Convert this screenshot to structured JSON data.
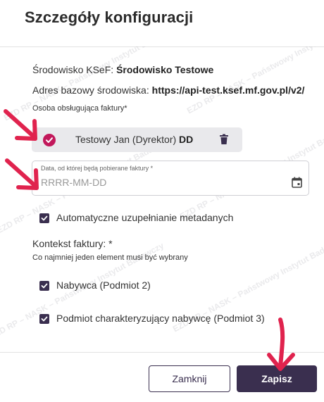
{
  "dialog": {
    "title": "Szczegóły konfiguracji"
  },
  "environment": {
    "label": "Środowisko KSeF:",
    "value": "Środowisko Testowe"
  },
  "base_address": {
    "label": "Adres bazowy środowiska:",
    "value": "https://api-test.ksef.mf.gov.pl/v2/"
  },
  "invoice_person": {
    "label": "Osoba obsługująca faktury*",
    "name": "Testowy Jan (Dyrektor)",
    "suffix": "DD"
  },
  "date_field": {
    "label": "Data, od której będą pobierane faktury *",
    "placeholder": "RRRR-MM-DD",
    "value": ""
  },
  "auto_metadata": {
    "label": "Automatyczne uzupełnianie metadanych",
    "checked": true
  },
  "invoice_context": {
    "heading": "Kontekst faktury: *",
    "hint": "Co najmniej jeden element musi być wybrany",
    "options": [
      {
        "label": "Nabywca (Podmiot 2)",
        "checked": true
      },
      {
        "label": "Podmiot charakteryzujący nabywcę (Podmiot 3)",
        "checked": true
      }
    ]
  },
  "footer": {
    "close_label": "Zamknij",
    "save_label": "Zapisz"
  },
  "watermark": {
    "text": "EZD RP – NASK – Państwowy Instytut Badawczy"
  },
  "colors": {
    "accent": "#3a2f4f",
    "check_pink": "#c2185b",
    "annotation_arrow": "#e0234e"
  }
}
